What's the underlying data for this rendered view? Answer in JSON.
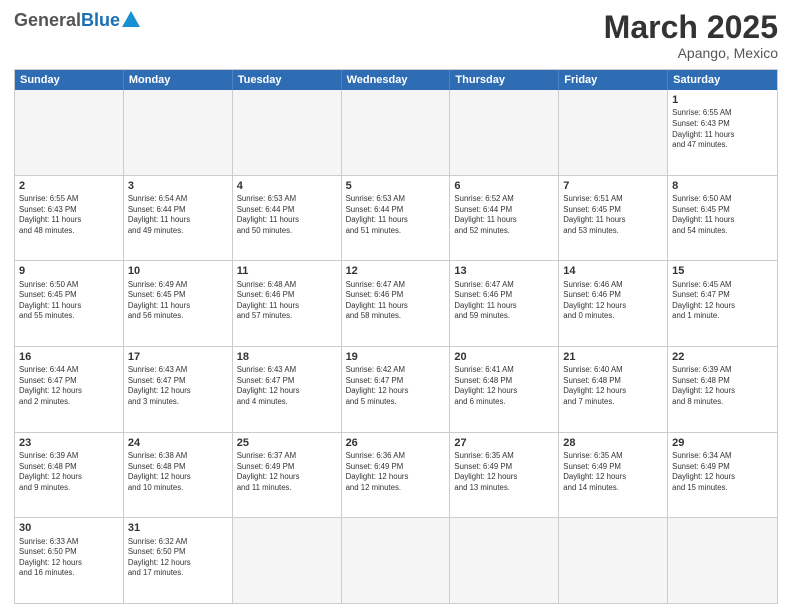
{
  "header": {
    "logo": {
      "general": "General",
      "blue": "Blue",
      "subtitle": ""
    },
    "title": "March 2025",
    "subtitle": "Apango, Mexico"
  },
  "calendar": {
    "weekdays": [
      "Sunday",
      "Monday",
      "Tuesday",
      "Wednesday",
      "Thursday",
      "Friday",
      "Saturday"
    ],
    "rows": [
      [
        {
          "day": "",
          "info": ""
        },
        {
          "day": "",
          "info": ""
        },
        {
          "day": "",
          "info": ""
        },
        {
          "day": "",
          "info": ""
        },
        {
          "day": "",
          "info": ""
        },
        {
          "day": "",
          "info": ""
        },
        {
          "day": "1",
          "info": "Sunrise: 6:55 AM\nSunset: 6:43 PM\nDaylight: 11 hours\nand 47 minutes."
        }
      ],
      [
        {
          "day": "2",
          "info": "Sunrise: 6:55 AM\nSunset: 6:43 PM\nDaylight: 11 hours\nand 48 minutes."
        },
        {
          "day": "3",
          "info": "Sunrise: 6:54 AM\nSunset: 6:44 PM\nDaylight: 11 hours\nand 49 minutes."
        },
        {
          "day": "4",
          "info": "Sunrise: 6:53 AM\nSunset: 6:44 PM\nDaylight: 11 hours\nand 50 minutes."
        },
        {
          "day": "5",
          "info": "Sunrise: 6:53 AM\nSunset: 6:44 PM\nDaylight: 11 hours\nand 51 minutes."
        },
        {
          "day": "6",
          "info": "Sunrise: 6:52 AM\nSunset: 6:44 PM\nDaylight: 11 hours\nand 52 minutes."
        },
        {
          "day": "7",
          "info": "Sunrise: 6:51 AM\nSunset: 6:45 PM\nDaylight: 11 hours\nand 53 minutes."
        },
        {
          "day": "8",
          "info": "Sunrise: 6:50 AM\nSunset: 6:45 PM\nDaylight: 11 hours\nand 54 minutes."
        }
      ],
      [
        {
          "day": "9",
          "info": "Sunrise: 6:50 AM\nSunset: 6:45 PM\nDaylight: 11 hours\nand 55 minutes."
        },
        {
          "day": "10",
          "info": "Sunrise: 6:49 AM\nSunset: 6:45 PM\nDaylight: 11 hours\nand 56 minutes."
        },
        {
          "day": "11",
          "info": "Sunrise: 6:48 AM\nSunset: 6:46 PM\nDaylight: 11 hours\nand 57 minutes."
        },
        {
          "day": "12",
          "info": "Sunrise: 6:47 AM\nSunset: 6:46 PM\nDaylight: 11 hours\nand 58 minutes."
        },
        {
          "day": "13",
          "info": "Sunrise: 6:47 AM\nSunset: 6:46 PM\nDaylight: 11 hours\nand 59 minutes."
        },
        {
          "day": "14",
          "info": "Sunrise: 6:46 AM\nSunset: 6:46 PM\nDaylight: 12 hours\nand 0 minutes."
        },
        {
          "day": "15",
          "info": "Sunrise: 6:45 AM\nSunset: 6:47 PM\nDaylight: 12 hours\nand 1 minute."
        }
      ],
      [
        {
          "day": "16",
          "info": "Sunrise: 6:44 AM\nSunset: 6:47 PM\nDaylight: 12 hours\nand 2 minutes."
        },
        {
          "day": "17",
          "info": "Sunrise: 6:43 AM\nSunset: 6:47 PM\nDaylight: 12 hours\nand 3 minutes."
        },
        {
          "day": "18",
          "info": "Sunrise: 6:43 AM\nSunset: 6:47 PM\nDaylight: 12 hours\nand 4 minutes."
        },
        {
          "day": "19",
          "info": "Sunrise: 6:42 AM\nSunset: 6:47 PM\nDaylight: 12 hours\nand 5 minutes."
        },
        {
          "day": "20",
          "info": "Sunrise: 6:41 AM\nSunset: 6:48 PM\nDaylight: 12 hours\nand 6 minutes."
        },
        {
          "day": "21",
          "info": "Sunrise: 6:40 AM\nSunset: 6:48 PM\nDaylight: 12 hours\nand 7 minutes."
        },
        {
          "day": "22",
          "info": "Sunrise: 6:39 AM\nSunset: 6:48 PM\nDaylight: 12 hours\nand 8 minutes."
        }
      ],
      [
        {
          "day": "23",
          "info": "Sunrise: 6:39 AM\nSunset: 6:48 PM\nDaylight: 12 hours\nand 9 minutes."
        },
        {
          "day": "24",
          "info": "Sunrise: 6:38 AM\nSunset: 6:48 PM\nDaylight: 12 hours\nand 10 minutes."
        },
        {
          "day": "25",
          "info": "Sunrise: 6:37 AM\nSunset: 6:49 PM\nDaylight: 12 hours\nand 11 minutes."
        },
        {
          "day": "26",
          "info": "Sunrise: 6:36 AM\nSunset: 6:49 PM\nDaylight: 12 hours\nand 12 minutes."
        },
        {
          "day": "27",
          "info": "Sunrise: 6:35 AM\nSunset: 6:49 PM\nDaylight: 12 hours\nand 13 minutes."
        },
        {
          "day": "28",
          "info": "Sunrise: 6:35 AM\nSunset: 6:49 PM\nDaylight: 12 hours\nand 14 minutes."
        },
        {
          "day": "29",
          "info": "Sunrise: 6:34 AM\nSunset: 6:49 PM\nDaylight: 12 hours\nand 15 minutes."
        }
      ],
      [
        {
          "day": "30",
          "info": "Sunrise: 6:33 AM\nSunset: 6:50 PM\nDaylight: 12 hours\nand 16 minutes."
        },
        {
          "day": "31",
          "info": "Sunrise: 6:32 AM\nSunset: 6:50 PM\nDaylight: 12 hours\nand 17 minutes."
        },
        {
          "day": "",
          "info": ""
        },
        {
          "day": "",
          "info": ""
        },
        {
          "day": "",
          "info": ""
        },
        {
          "day": "",
          "info": ""
        },
        {
          "day": "",
          "info": ""
        }
      ]
    ]
  }
}
